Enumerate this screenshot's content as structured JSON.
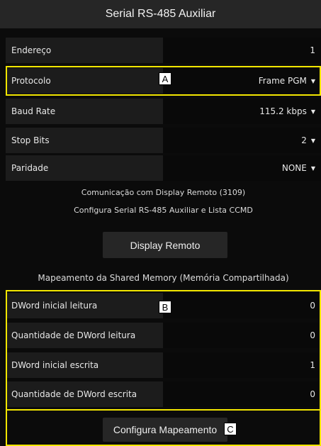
{
  "title": "Serial RS-485 Auxiliar",
  "settings": [
    {
      "label": "Endereço",
      "value": "1",
      "dropdown": false
    },
    {
      "label": "Protocolo",
      "value": "Frame PGM",
      "dropdown": true
    },
    {
      "label": "Baud Rate",
      "value": "115.2 kbps",
      "dropdown": true
    },
    {
      "label": "Stop Bits",
      "value": "2",
      "dropdown": true
    },
    {
      "label": "Paridade",
      "value": "NONE",
      "dropdown": true
    }
  ],
  "info_line1": "Comunicação com Display Remoto (3109)",
  "info_line2": "Configura Serial RS-485 Auxiliar e Lista CCMD",
  "display_button": "Display Remoto",
  "mapping_title": "Mapeamento da Shared Memory (Memória Compartilhada)",
  "mapping": [
    {
      "label": "DWord inicial leitura",
      "value": "0"
    },
    {
      "label": "Quantidade de DWord leitura",
      "value": "0"
    },
    {
      "label": "DWord inicial escrita",
      "value": "1"
    },
    {
      "label": "Quantidade de DWord escrita",
      "value": "0"
    }
  ],
  "config_button": "Configura Mapeamento",
  "caret": "▼",
  "annotations": {
    "a": "A",
    "b": "B",
    "c": "C"
  },
  "highlight_color": "#f2e600"
}
